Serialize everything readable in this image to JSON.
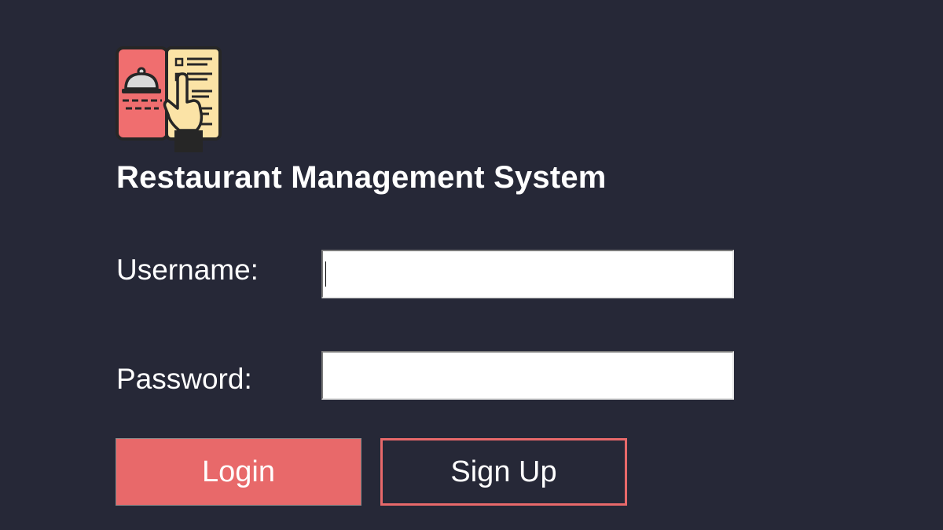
{
  "app": {
    "title": "Restaurant Management System",
    "logo_icon": "restaurant-menu-icon"
  },
  "form": {
    "username_label": "Username:",
    "username_value": "",
    "password_label": "Password:",
    "password_value": ""
  },
  "buttons": {
    "login_label": "Login",
    "signup_label": "Sign Up"
  },
  "colors": {
    "background": "#262837",
    "accent": "#e8696a",
    "text": "#ffffff",
    "input_bg": "#ffffff"
  }
}
